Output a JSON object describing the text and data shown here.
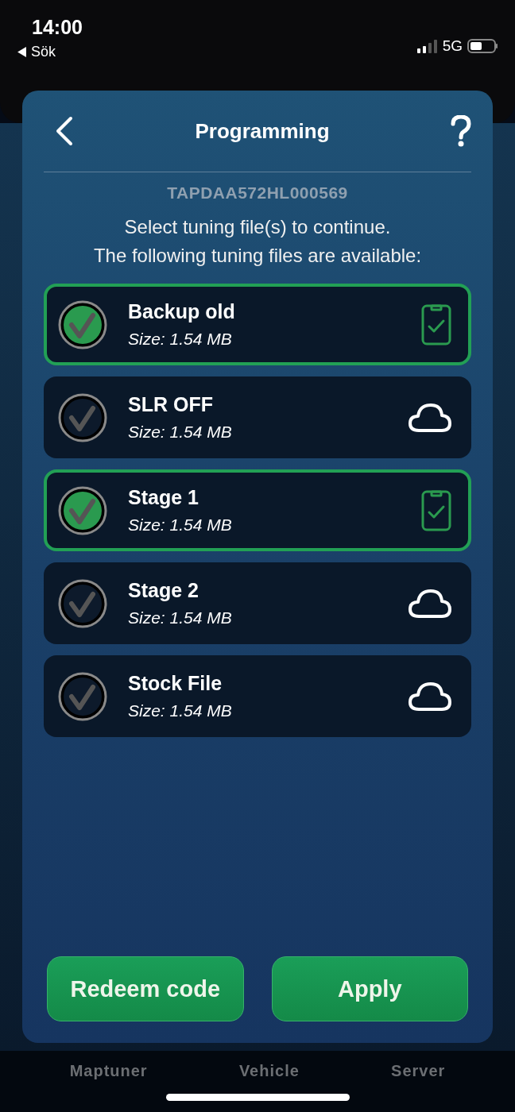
{
  "status_bar": {
    "time": "14:00",
    "back_label": "Sök",
    "network": "5G"
  },
  "dialog": {
    "title": "Programming",
    "vin": "TAPDAA572HL000569",
    "instructions": [
      "Select tuning file(s) to continue.",
      "The following tuning files are available:"
    ],
    "files": [
      {
        "name": "Backup old",
        "size": "Size: 1.54 MB",
        "selected": true,
        "kind": "local"
      },
      {
        "name": "SLR OFF",
        "size": "Size: 1.54 MB",
        "selected": false,
        "kind": "cloud"
      },
      {
        "name": "Stage 1",
        "size": "Size: 1.54 MB",
        "selected": true,
        "kind": "local"
      },
      {
        "name": "Stage 2",
        "size": "Size: 1.54 MB",
        "selected": false,
        "kind": "cloud"
      },
      {
        "name": "Stock File",
        "size": "Size: 1.54 MB",
        "selected": false,
        "kind": "cloud"
      }
    ],
    "buttons": [
      "Redeem code",
      "Apply"
    ]
  },
  "tab_bar": [
    "Maptuner",
    "Vehicle",
    "Server"
  ]
}
